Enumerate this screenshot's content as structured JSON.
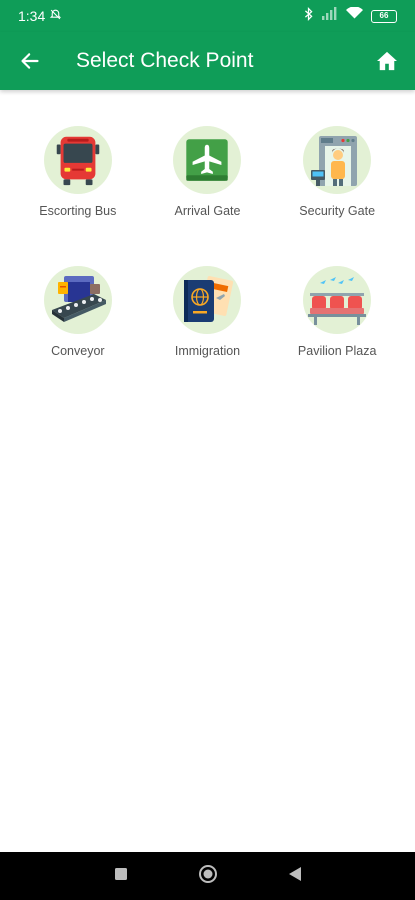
{
  "status_bar": {
    "time": "1:34",
    "battery": "66"
  },
  "app_bar": {
    "title": "Select Check Point"
  },
  "checkpoints": [
    {
      "label": "Escorting Bus",
      "icon": "bus-icon"
    },
    {
      "label": "Arrival Gate",
      "icon": "airplane-icon"
    },
    {
      "label": "Security Gate",
      "icon": "security-gate-icon"
    },
    {
      "label": "Conveyor",
      "icon": "conveyor-icon"
    },
    {
      "label": "Immigration",
      "icon": "passport-icon"
    },
    {
      "label": "Pavilion Plaza",
      "icon": "waiting-chairs-icon"
    }
  ],
  "colors": {
    "primary": "#0f9d58",
    "icon_bg": "#e3f1d5"
  }
}
